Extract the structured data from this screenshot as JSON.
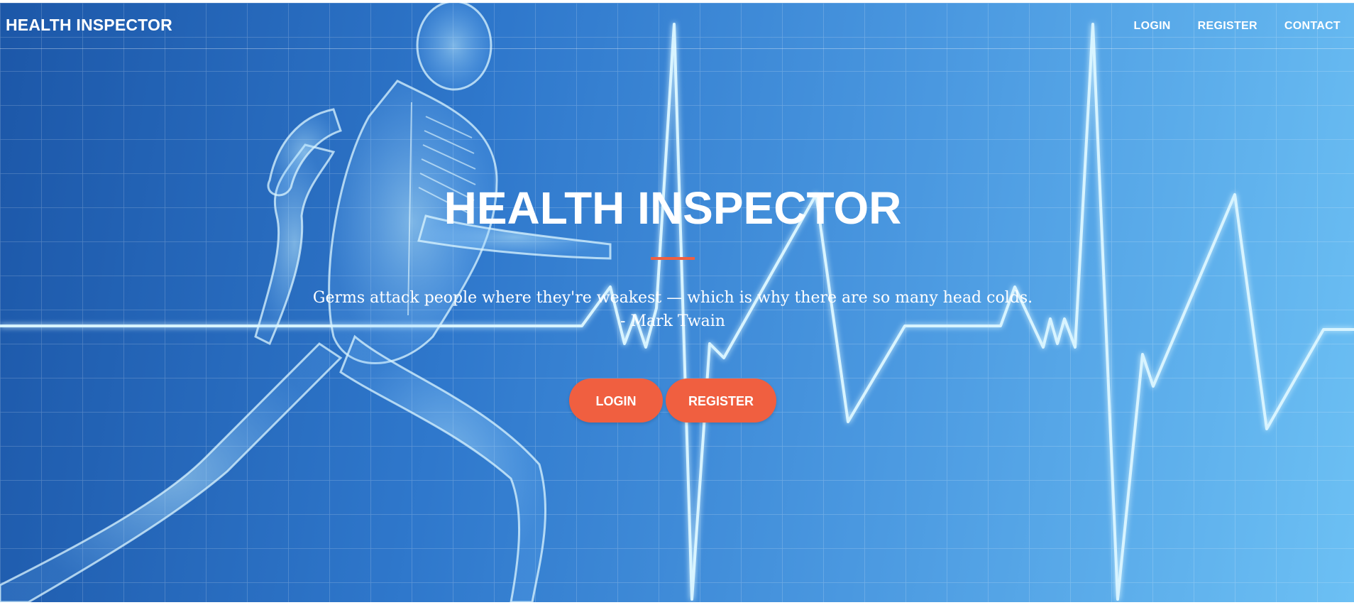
{
  "navbar": {
    "brand": "HEALTH INSPECTOR",
    "links": [
      {
        "label": "LOGIN"
      },
      {
        "label": "REGISTER"
      },
      {
        "label": "CONTACT"
      }
    ]
  },
  "hero": {
    "title": "HEALTH INSPECTOR",
    "quote": "Germs attack people where they're weakest — which is why there are so many head colds. - Mark Twain",
    "buttons": {
      "login": "LOGIN",
      "register": "REGISTER"
    },
    "background_image": "x-ray-runner-with-heartbeat-line"
  },
  "colors": {
    "accent": "#f05f40",
    "hero_blue_dark": "#1c57a8",
    "hero_blue_light": "#6cc0f4",
    "text": "#ffffff"
  }
}
